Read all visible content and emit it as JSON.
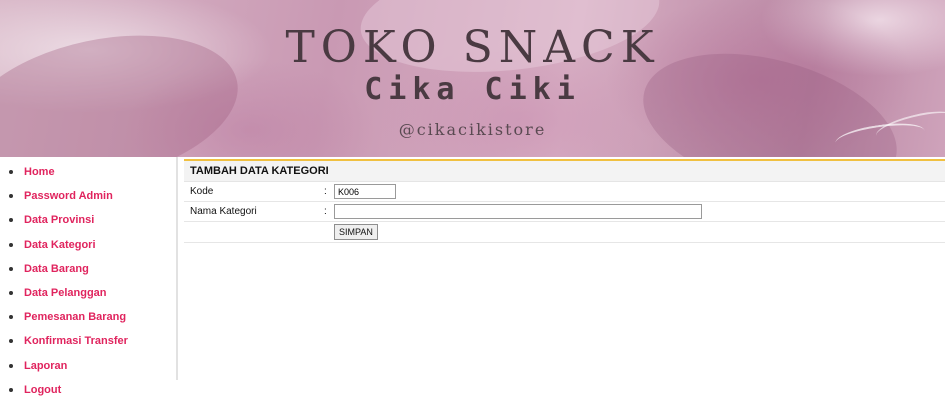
{
  "banner": {
    "title": "TOKO SNACK",
    "subtitle": "Cika Ciki",
    "handle": "@cikacikistore"
  },
  "sidebar": {
    "items": [
      {
        "label": "Home"
      },
      {
        "label": "Password Admin"
      },
      {
        "label": "Data Provinsi"
      },
      {
        "label": "Data Kategori"
      },
      {
        "label": "Data Barang"
      },
      {
        "label": "Data Pelanggan"
      },
      {
        "label": "Pemesanan Barang"
      },
      {
        "label": "Konfirmasi Transfer"
      },
      {
        "label": "Laporan"
      },
      {
        "label": "Logout"
      }
    ]
  },
  "form": {
    "heading": "TAMBAH DATA KATEGORI",
    "kode": {
      "label": "Kode",
      "colon": ":",
      "value": "K006"
    },
    "nama": {
      "label": "Nama Kategori",
      "colon": ":",
      "value": ""
    },
    "submit_label": "SIMPAN"
  },
  "colors": {
    "link": "#e0245e",
    "accent_line": "#f0c040",
    "banner_tone": "#c999b3"
  }
}
